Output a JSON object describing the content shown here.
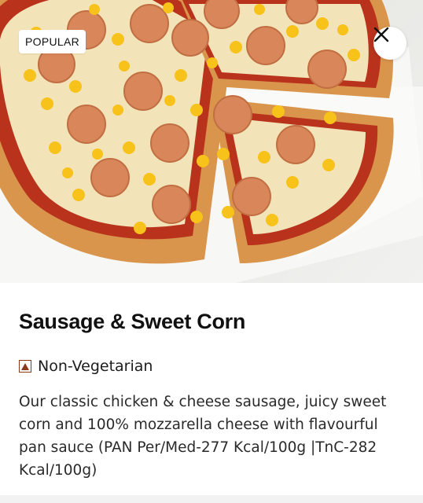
{
  "hero": {
    "badge": "POPULAR",
    "close_icon": "close-icon"
  },
  "product": {
    "title": "Sausage & Sweet Corn",
    "diet_label": "Non-Vegetarian",
    "diet_icon": "non-veg-icon",
    "description": "Our classic chicken & cheese sausage, juicy sweet corn and 100% mozzarella cheese with flavourful pan sauce (PAN Per/Med-277 Kcal/100g |TnC-282 Kcal/100g)"
  },
  "colors": {
    "crust": "#d8954a",
    "cheese": "#f3e7c2",
    "sauce": "#b8321c",
    "sausage": "#d9865a",
    "corn": "#f7c21a",
    "non_veg_brown": "#8b3a1a"
  }
}
